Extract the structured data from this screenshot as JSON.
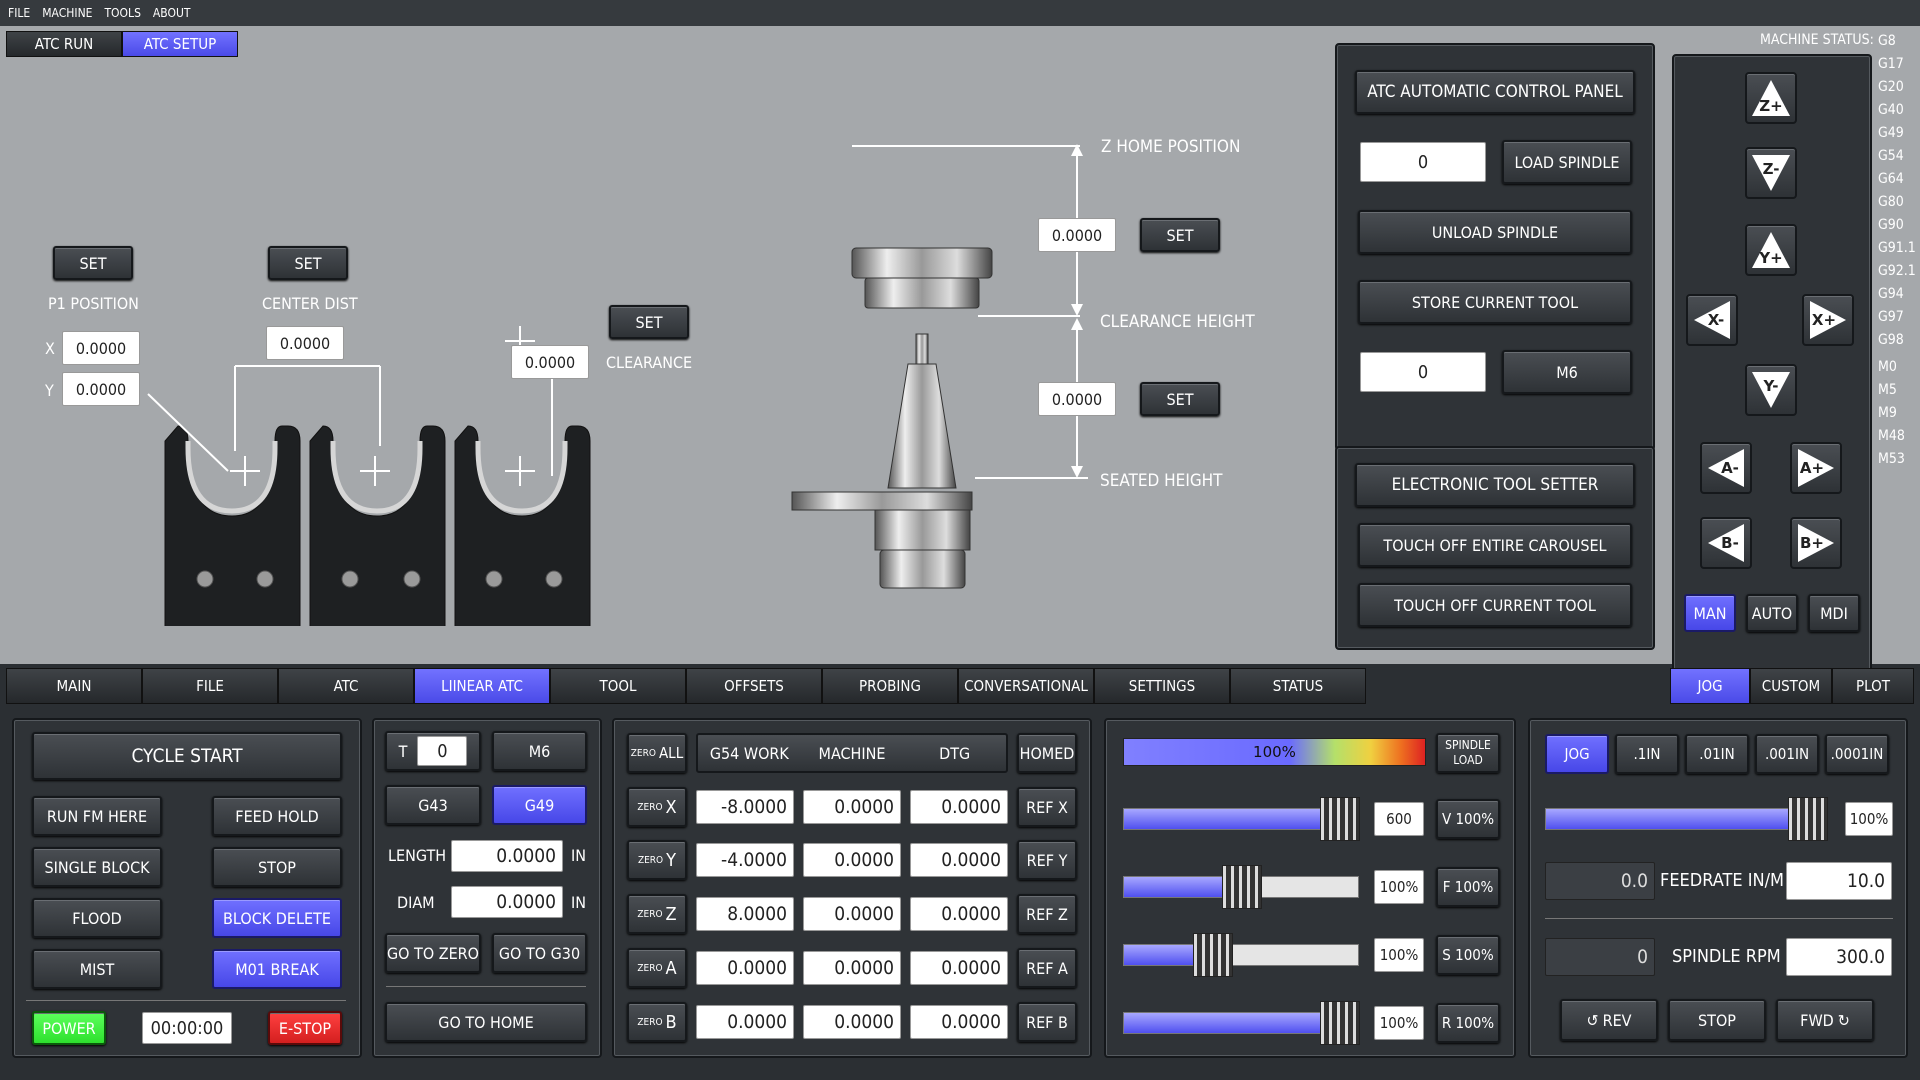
{
  "menu": [
    "FILE",
    "MACHINE",
    "TOOLS",
    "ABOUT"
  ],
  "top_tabs": [
    {
      "label": "ATC RUN",
      "active": false
    },
    {
      "label": "ATC SETUP",
      "active": true
    }
  ],
  "carousel": {
    "p1_set": "SET",
    "p1_label": "P1 POSITION",
    "x_label": "X",
    "y_label": "Y",
    "p1_x": "0.0000",
    "p1_y": "0.0000",
    "center_set": "SET",
    "center_label": "CENTER DIST",
    "center_value": "0.0000",
    "clearance_set": "SET",
    "clearance_label": "CLEARANCE",
    "clearance_value": "0.0000"
  },
  "spindle_diagram": {
    "z_home_label": "Z HOME POSITION",
    "z_home_value": "0.0000",
    "z_home_set": "SET",
    "clearance_height_label": "CLEARANCE HEIGHT",
    "seated_value": "0.0000",
    "seated_set": "SET",
    "seated_height_label": "SEATED HEIGHT"
  },
  "atc_panel": {
    "title": "ATC AUTOMATIC CONTROL PANEL",
    "load_value": "0",
    "load_button": "LOAD SPINDLE",
    "unload_button": "UNLOAD SPINDLE",
    "store_button": "STORE CURRENT TOOL",
    "m6_value": "0",
    "m6_button": "M6"
  },
  "tool_setter": {
    "title": "ELECTRONIC TOOL SETTER",
    "touch_carousel": "TOUCH OFF ENTIRE CAROUSEL",
    "touch_current": "TOUCH OFF CURRENT TOOL"
  },
  "jog_buttons": [
    "Z+",
    "Z-",
    "Y+",
    "X-",
    "X+",
    "Y-",
    "A-",
    "A+",
    "B-",
    "B+"
  ],
  "mode_buttons": [
    {
      "label": "MAN",
      "active": true
    },
    {
      "label": "AUTO",
      "active": false
    },
    {
      "label": "MDI",
      "active": false
    }
  ],
  "machine_status": {
    "label": "MACHINE STATUS:",
    "codes": [
      "G8",
      "G17",
      "G20",
      "G40",
      "G49",
      "G54",
      "G64",
      "G80",
      "G90",
      "G91.1",
      "G92.1",
      "G94",
      "G97",
      "G98",
      "M0",
      "M5",
      "M9",
      "M48",
      "M53"
    ]
  },
  "main_tabs": [
    {
      "label": "MAIN",
      "active": false
    },
    {
      "label": "FILE",
      "active": false
    },
    {
      "label": "ATC",
      "active": false
    },
    {
      "label": "LIINEAR ATC",
      "active": true
    },
    {
      "label": "TOOL",
      "active": false
    },
    {
      "label": "OFFSETS",
      "active": false
    },
    {
      "label": "PROBING",
      "active": false
    },
    {
      "label": "CONVERSATIONAL",
      "active": false
    },
    {
      "label": "SETTINGS",
      "active": false
    },
    {
      "label": "STATUS",
      "active": false
    }
  ],
  "right_tabs": [
    {
      "label": "JOG",
      "active": true
    },
    {
      "label": "CUSTOM",
      "active": false
    },
    {
      "label": "PLOT",
      "active": false
    }
  ],
  "controls": {
    "cycle_start": "CYCLE START",
    "run_from_here": "RUN FM HERE",
    "feed_hold": "FEED HOLD",
    "single_block": "SINGLE BLOCK",
    "stop": "STOP",
    "flood": "FLOOD",
    "block_delete": "BLOCK DELETE",
    "mist": "MIST",
    "m01_break": "M01 BREAK",
    "power": "POWER",
    "timer": "00:00:00",
    "estop": "E-STOP"
  },
  "tool_box": {
    "t_label": "T",
    "t_value": "0",
    "m6": "M6",
    "g43": "G43",
    "g49": "G49",
    "length_label": "LENGTH",
    "length_value": "0.0000",
    "diam_label": "DIAM",
    "diam_value": "0.0000",
    "unit": "IN",
    "go_zero": "GO TO ZERO",
    "go_g30": "GO TO G30",
    "go_home": "GO TO HOME"
  },
  "dro": {
    "zero_all_small": "ZERO",
    "zero_all": "ALL",
    "headers": [
      "G54 WORK",
      "MACHINE",
      "DTG"
    ],
    "homed": "HOMED",
    "axes": [
      {
        "axis": "X",
        "work": "-8.0000",
        "machine": "0.0000",
        "dtg": "0.0000",
        "ref": "REF X"
      },
      {
        "axis": "Y",
        "work": "-4.0000",
        "machine": "0.0000",
        "dtg": "0.0000",
        "ref": "REF Y"
      },
      {
        "axis": "Z",
        "work": "8.0000",
        "machine": "0.0000",
        "dtg": "0.0000",
        "ref": "REF Z"
      },
      {
        "axis": "A",
        "work": "0.0000",
        "machine": "0.0000",
        "dtg": "0.0000",
        "ref": "REF A"
      },
      {
        "axis": "B",
        "work": "0.0000",
        "machine": "0.0000",
        "dtg": "0.0000",
        "ref": "REF B"
      }
    ]
  },
  "overrides": {
    "spindle_load": "100%",
    "spindle_load_label_1": "SPINDLE",
    "spindle_load_label_2": "LOAD",
    "rows": [
      {
        "value": "600",
        "button": "V 100%",
        "level": 1.0
      },
      {
        "value": "100%",
        "button": "F 100%",
        "level": 0.5
      },
      {
        "value": "100%",
        "button": "S 100%",
        "level": 0.35
      },
      {
        "value": "100%",
        "button": "R 100%",
        "level": 1.0
      }
    ]
  },
  "jog_panel": {
    "increments": [
      {
        "label": "JOG",
        "active": true
      },
      {
        "label": ".1IN",
        "active": false
      },
      {
        "label": ".01IN",
        "active": false
      },
      {
        "label": ".001IN",
        "active": false
      },
      {
        "label": ".0001IN",
        "active": false
      }
    ],
    "jog_rate": "100%",
    "jog_level": 1.0,
    "feedrate_actual": "0.0",
    "feedrate_label": "FEEDRATE IN/M",
    "feedrate_set": "10.0",
    "rpm_actual": "0",
    "rpm_label": "SPINDLE RPM",
    "rpm_set": "300.0",
    "rev": "REV",
    "stop": "STOP",
    "fwd": "FWD"
  }
}
